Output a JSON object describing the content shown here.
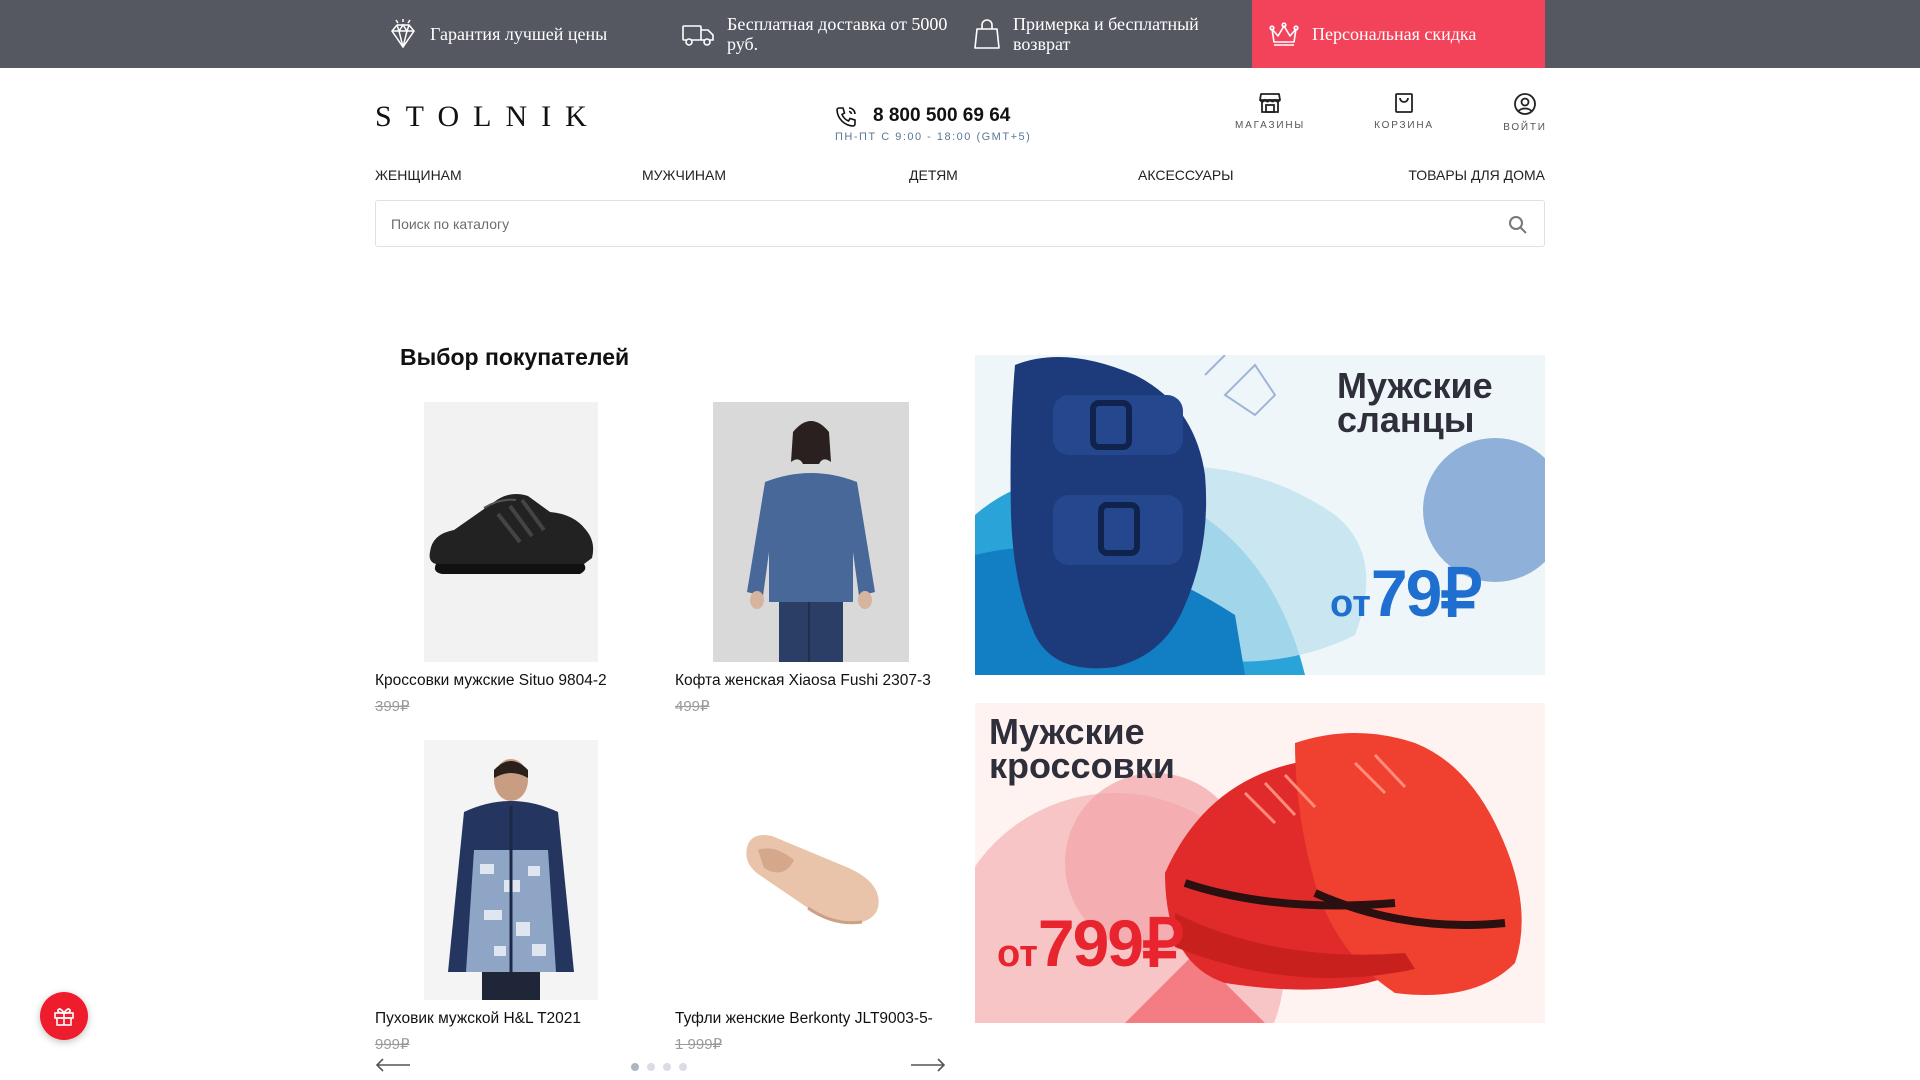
{
  "topbar": {
    "perks": [
      {
        "icon": "diamond-icon",
        "label": "Гарантия лучшей цены"
      },
      {
        "icon": "truck-icon",
        "label": "Бесплатная доставка от 5000 руб."
      },
      {
        "icon": "shopping-bag-icon",
        "label": "Примерка и бесплатный возврат"
      },
      {
        "icon": "crown-icon",
        "label": "Персональная скидка"
      }
    ],
    "background": "#555861",
    "accent": "#f3435b"
  },
  "header": {
    "logo": "STOLNIK",
    "phone": "8 800 500 69 64",
    "hours": "ПН-ПТ С 9:00 - 18:00 (GMT+5)",
    "links": {
      "stores": "МАГАЗИНЫ",
      "cart": "КОРЗИНА",
      "login": "ВОЙТИ"
    }
  },
  "nav": {
    "items": [
      "ЖЕНЩИНАМ",
      "МУЖЧИНАМ",
      "ДЕТЯМ",
      "АКСЕССУАРЫ",
      "ТОВАРЫ ДЛЯ ДОМА"
    ]
  },
  "search": {
    "placeholder": "Поиск по каталогу",
    "value": ""
  },
  "bestsellers": {
    "title": "Выбор покупателей",
    "products": [
      {
        "name": "Кроссовки мужские Situo 9804-2",
        "price": "399₽"
      },
      {
        "name": "Кофта женская Xiaosa Fushi 2307-3",
        "price": "499₽"
      },
      {
        "name": "Пуховик мужской H&L T2021",
        "price": "999₽"
      },
      {
        "name": "Туфли женские Berkonty JLT9003-5-",
        "price": "1 999₽"
      }
    ],
    "pager": {
      "pages": 4,
      "current": 1
    }
  },
  "banners": [
    {
      "title_line1": "Мужские",
      "title_line2": "сланцы",
      "price_prefix": "от",
      "price": "79₽"
    },
    {
      "title_line1": "Мужские",
      "title_line2": "кроссовки",
      "price_prefix": "от",
      "price": "799₽"
    }
  ],
  "colors": {
    "brand_red": "#ef1c2d",
    "banner_blue": "#1e6fd0",
    "banner_red": "#e8242e"
  }
}
